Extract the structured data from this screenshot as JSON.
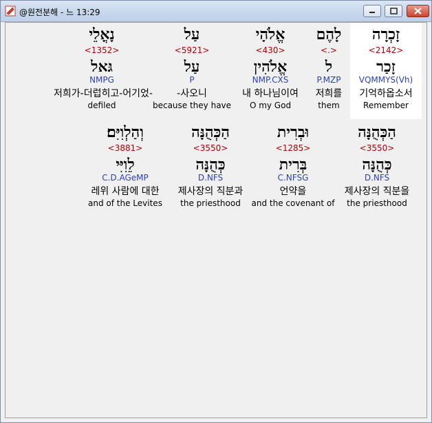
{
  "window": {
    "title": "@원전분해 - 느 13:29"
  },
  "rows": [
    [
      {
        "hebrew": "נָאֳלֵי",
        "strong": "<1352>",
        "lemma": "גּאל",
        "morph": "NMPG",
        "korean": "저희가-더럽히고-어기었-",
        "english": "defiled"
      },
      {
        "hebrew": "עַל",
        "strong": "<5921>",
        "lemma": "עַל",
        "morph": "P",
        "korean": "-사오니",
        "english": "because they have"
      },
      {
        "hebrew": "אֱלֹהָי",
        "strong": "<430>",
        "lemma": "אֱלֹהִין",
        "morph": "NMP.CXS",
        "korean": "내 하나님이여",
        "english": "O my God"
      },
      {
        "hebrew": "לָהֶם",
        "strong": "<.>",
        "lemma": "ל",
        "morph": "P.MZP",
        "korean": "저희를",
        "english": "them"
      },
      {
        "hebrew": "זָכְרָה",
        "strong": "<2142>",
        "lemma": "זָכַר",
        "morph": "VQMMYS(Vh)",
        "korean": "기억하옵소서",
        "english": "Remember"
      }
    ],
    [
      {
        "hebrew": "וְהַלְוִיִּם׃",
        "strong": "<3881>",
        "lemma": "לֵוִיִּי",
        "morph": "C.D.AGeMP",
        "korean": "레위 사람에 대한",
        "english": "and of the Levites"
      },
      {
        "hebrew": "הַכְּהֻנָּה",
        "strong": "<3550>",
        "lemma": "כְּהֻנָּה",
        "morph": "D.NFS",
        "korean": "제사장의 직분과",
        "english": "the priesthood"
      },
      {
        "hebrew": "וּבְרִית",
        "strong": "<1285>",
        "lemma": "בְּרִית",
        "morph": "C.NFSG",
        "korean": "언약을",
        "english": "and the covenant of"
      },
      {
        "hebrew": "הַכְּהֻנָּה",
        "strong": "<3550>",
        "lemma": "כְּהֻנָּה",
        "morph": "D.NFS",
        "korean": "제사장의 직분을",
        "english": "the priesthood"
      }
    ]
  ]
}
